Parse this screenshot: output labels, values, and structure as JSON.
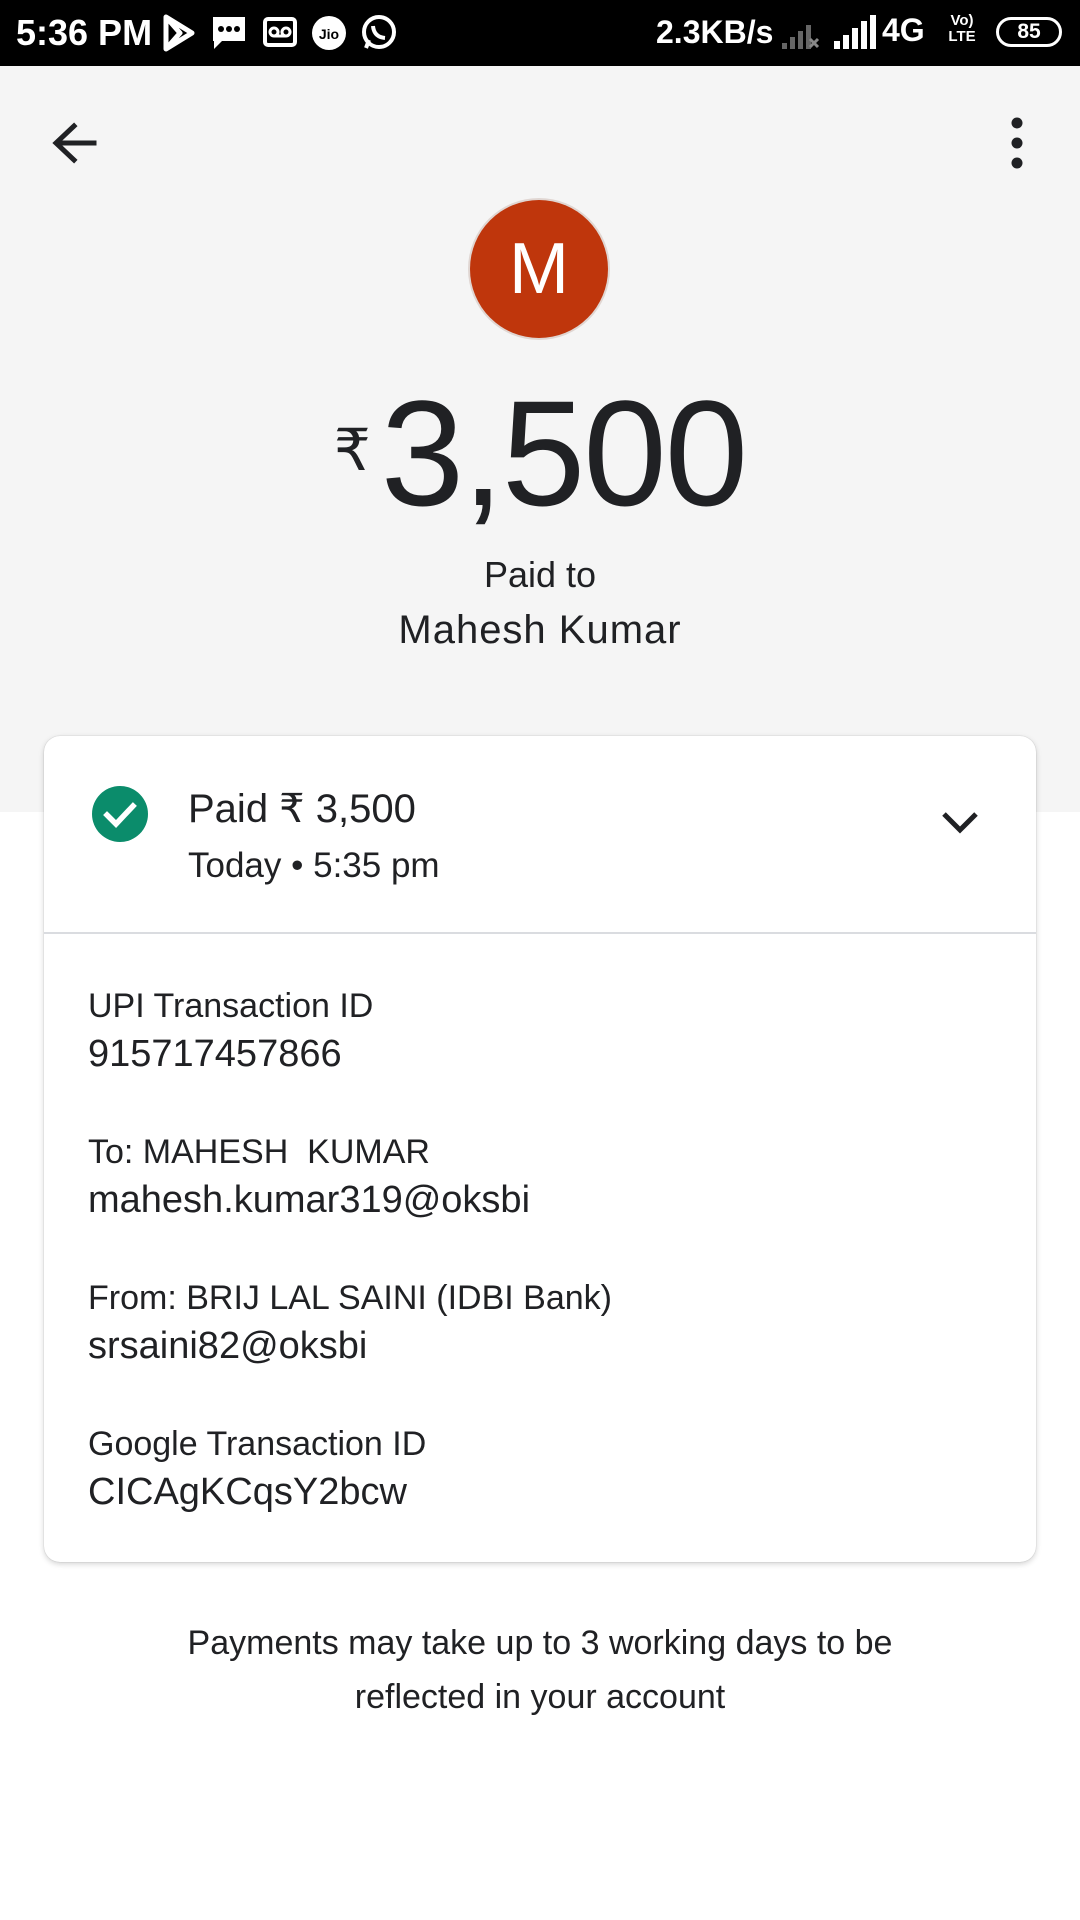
{
  "status_bar": {
    "time": "5:36 PM",
    "speed": "2.3KB/s",
    "network": "4G",
    "volte_top": "Vo)",
    "volte_bottom": "LTE",
    "battery": "85",
    "icons": [
      "play-store-icon",
      "message-icon",
      "voicemail-icon",
      "jio-icon",
      "whatsapp-icon",
      "signal-icon"
    ]
  },
  "header": {
    "avatar_letter": "M",
    "avatar_color": "#bf360c",
    "currency_symbol": "₹",
    "amount": "3,500",
    "paid_to_label": "Paid to",
    "payee_name": "Mahesh Kumar"
  },
  "card": {
    "status_title": "Paid ₹ 3,500",
    "status_time": "Today • 5:35 pm",
    "status_color": "#0b8c6b",
    "details": [
      {
        "label": "UPI Transaction ID",
        "value": "915717457866"
      },
      {
        "label": "To: MAHESH  KUMAR",
        "value": "mahesh.kumar319@oksbi"
      },
      {
        "label": "From: BRIJ LAL SAINI (IDBI Bank)",
        "value": "srsaini82@oksbi"
      },
      {
        "label": "Google Transaction ID",
        "value": "CICAgKCqsY2bcw"
      }
    ]
  },
  "footer_note": "Payments may take up to 3 working days to be reflected in your account"
}
